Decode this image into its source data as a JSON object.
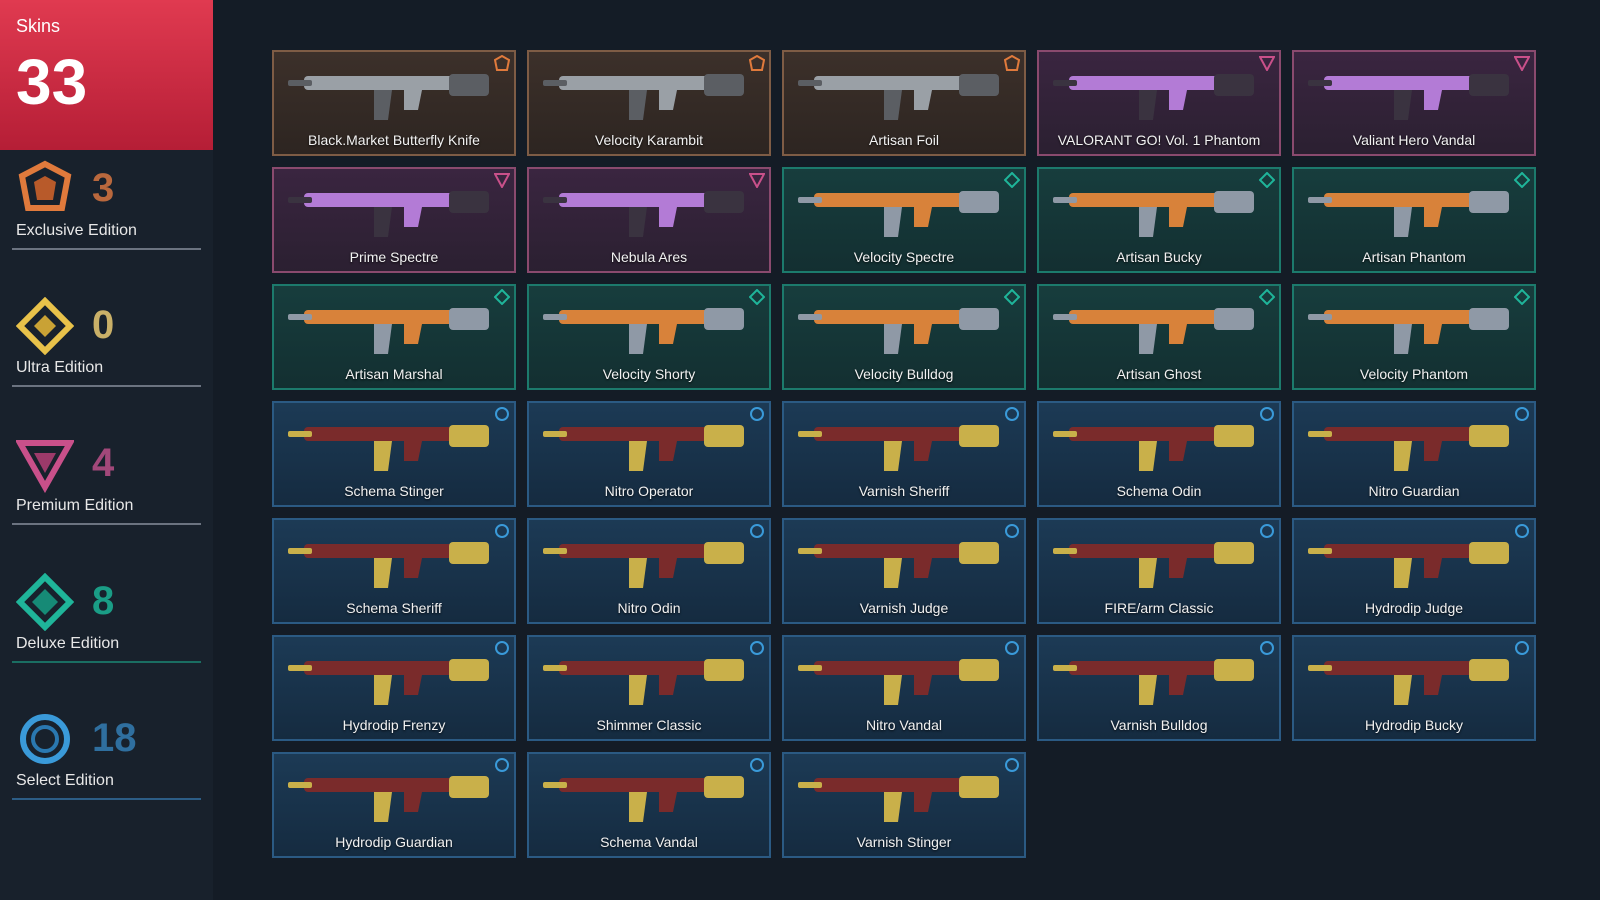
{
  "summary": {
    "label": "Skins",
    "total": "33"
  },
  "tiers": [
    {
      "key": "exclusive",
      "name": "Exclusive Edition",
      "count": "3",
      "icon": "exclusive-edition-icon",
      "color": "#e07a3c"
    },
    {
      "key": "ultra",
      "name": "Ultra Edition",
      "count": "0",
      "icon": "ultra-edition-icon",
      "color": "#e8c24a"
    },
    {
      "key": "premium",
      "name": "Premium Edition",
      "count": "4",
      "icon": "premium-edition-icon",
      "color": "#c9508a"
    },
    {
      "key": "deluxe",
      "name": "Deluxe Edition",
      "count": "8",
      "icon": "deluxe-edition-icon",
      "color": "#1fb59a"
    },
    {
      "key": "select",
      "name": "Select Edition",
      "count": "18",
      "icon": "select-edition-icon",
      "color": "#3a9ad9"
    }
  ],
  "skins": [
    {
      "name": "Black.Market Butterfly Knife",
      "tier": "exclusive"
    },
    {
      "name": "Velocity Karambit",
      "tier": "exclusive"
    },
    {
      "name": "Artisan Foil",
      "tier": "exclusive"
    },
    {
      "name": "VALORANT GO! Vol. 1 Phantom",
      "tier": "premium"
    },
    {
      "name": "Valiant Hero Vandal",
      "tier": "premium"
    },
    {
      "name": "Prime Spectre",
      "tier": "premium"
    },
    {
      "name": "Nebula Ares",
      "tier": "premium"
    },
    {
      "name": "Velocity Spectre",
      "tier": "deluxe"
    },
    {
      "name": "Artisan Bucky",
      "tier": "deluxe"
    },
    {
      "name": "Artisan Phantom",
      "tier": "deluxe"
    },
    {
      "name": "Artisan Marshal",
      "tier": "deluxe"
    },
    {
      "name": "Velocity Shorty",
      "tier": "deluxe"
    },
    {
      "name": "Velocity Bulldog",
      "tier": "deluxe"
    },
    {
      "name": "Artisan Ghost",
      "tier": "deluxe"
    },
    {
      "name": "Velocity Phantom",
      "tier": "deluxe"
    },
    {
      "name": "Schema Stinger",
      "tier": "select"
    },
    {
      "name": "Nitro Operator",
      "tier": "select"
    },
    {
      "name": "Varnish Sheriff",
      "tier": "select"
    },
    {
      "name": "Schema Odin",
      "tier": "select"
    },
    {
      "name": "Nitro Guardian",
      "tier": "select"
    },
    {
      "name": "Schema Sheriff",
      "tier": "select"
    },
    {
      "name": "Nitro Odin",
      "tier": "select"
    },
    {
      "name": "Varnish Judge",
      "tier": "select"
    },
    {
      "name": "FIRE/arm Classic",
      "tier": "select"
    },
    {
      "name": "Hydrodip Judge",
      "tier": "select"
    },
    {
      "name": "Hydrodip Frenzy",
      "tier": "select"
    },
    {
      "name": "Shimmer Classic",
      "tier": "select"
    },
    {
      "name": "Nitro Vandal",
      "tier": "select"
    },
    {
      "name": "Varnish Bulldog",
      "tier": "select"
    },
    {
      "name": "Hydrodip Bucky",
      "tier": "select"
    },
    {
      "name": "Hydrodip Guardian",
      "tier": "select"
    },
    {
      "name": "Schema Vandal",
      "tier": "select"
    },
    {
      "name": "Varnish Stinger",
      "tier": "select"
    }
  ]
}
